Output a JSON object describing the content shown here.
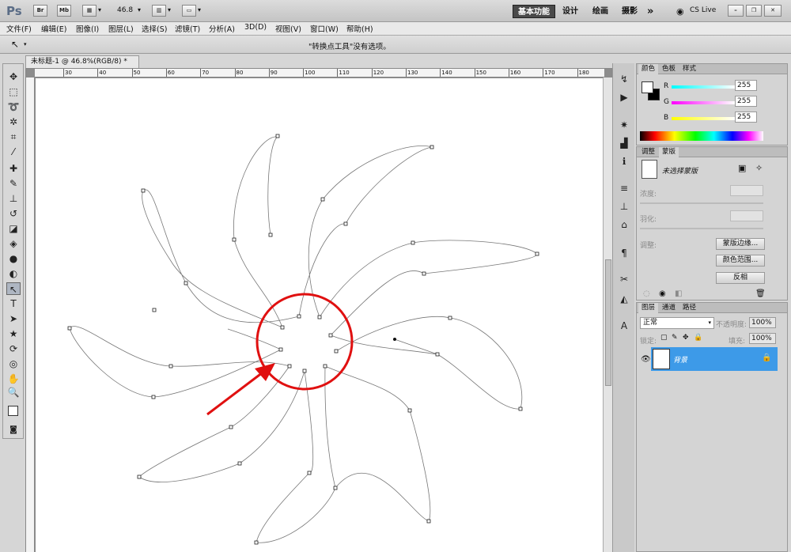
{
  "app": {
    "logo": "Ps",
    "zoom": "46.8",
    "workspaces": [
      "基本功能",
      "设计",
      "绘画",
      "摄影"
    ],
    "more": "»",
    "cs_live": "CS Live"
  },
  "menu": [
    "文件(F)",
    "编辑(E)",
    "图像(I)",
    "图层(L)",
    "选择(S)",
    "滤镜(T)",
    "分析(A)",
    "3D(D)",
    "视图(V)",
    "窗口(W)",
    "帮助(H)"
  ],
  "options": {
    "message": "\"转换点工具\"没有选项。"
  },
  "document": {
    "tab_title": "未标题-1 @ 46.8%(RGB/8) *",
    "ruler_h": [
      "30",
      "40",
      "50",
      "60",
      "70",
      "80",
      "90",
      "100",
      "110",
      "120",
      "130",
      "140",
      "150",
      "160",
      "170",
      "180"
    ]
  },
  "color_panel": {
    "tabs": [
      "颜色",
      "色板",
      "样式"
    ],
    "r_label": "R",
    "g_label": "G",
    "b_label": "B",
    "r": "255",
    "g": "255",
    "b": "255"
  },
  "mask_panel": {
    "tabs": [
      "调整",
      "蒙版"
    ],
    "no_mask": "未选择蒙版",
    "density": "浓度:",
    "feather": "羽化:",
    "refine": "调整:",
    "btn_edge": "蒙版边缘...",
    "btn_range": "颜色范围...",
    "btn_invert": "反相"
  },
  "layers_panel": {
    "tabs": [
      "图层",
      "通道",
      "路径"
    ],
    "blend": "正常",
    "opacity_label": "不透明度:",
    "opacity": "100%",
    "lock_label": "锁定:",
    "fill_label": "填充:",
    "fill": "100%",
    "layer_name": "背景"
  },
  "colors": {
    "accent": "#3d9ae8",
    "annotation": "#e01010"
  }
}
